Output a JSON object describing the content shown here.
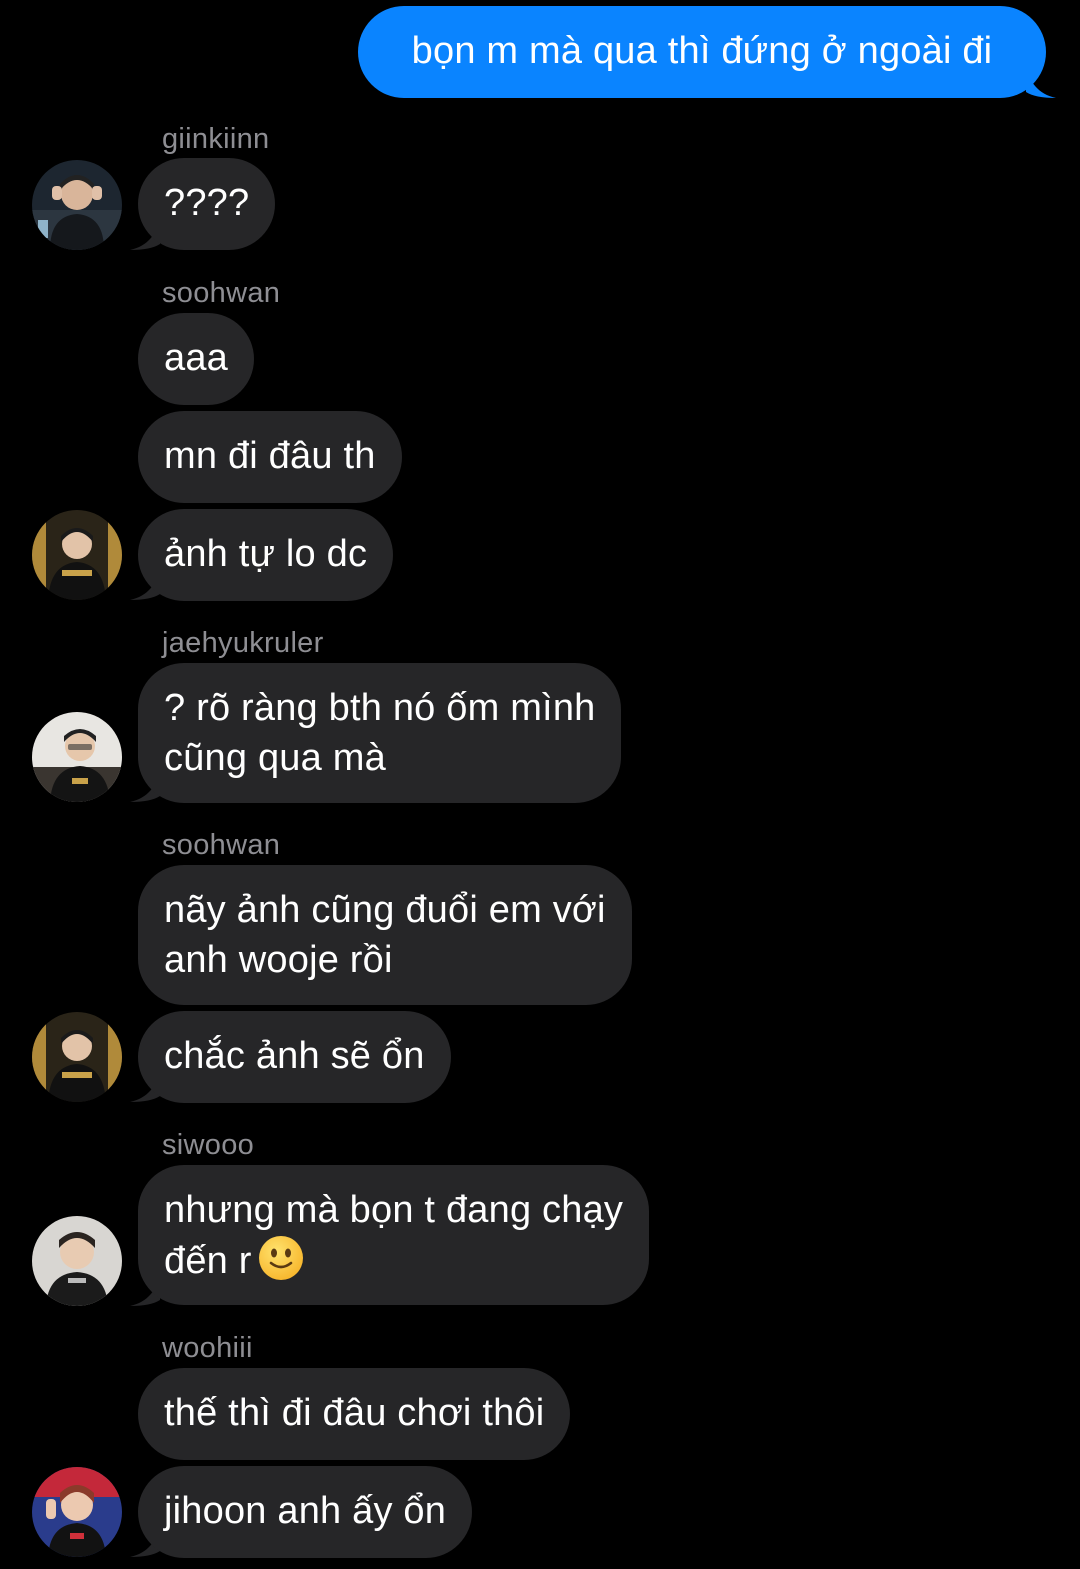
{
  "outgoing": {
    "text": "bọn m mà qua thì đứng ở ngoài đi"
  },
  "messages": {
    "m1": {
      "sender": "giinkiinn",
      "text": "????"
    },
    "m2": {
      "sender": "soohwan",
      "text": "aaa"
    },
    "m3": {
      "text": "mn đi đâu th"
    },
    "m4": {
      "text": "ảnh tự lo dc"
    },
    "m5": {
      "sender": "jaehyukruler",
      "line1": "? rõ ràng bth nó ốm mình",
      "line2": "cũng qua mà"
    },
    "m6": {
      "sender": "soohwan",
      "line1": "nãy ảnh cũng đuổi em với",
      "line2": "anh wooje rồi"
    },
    "m7": {
      "text": "chắc ảnh sẽ ổn"
    },
    "m8": {
      "sender": "siwooo",
      "line1": "nhưng mà bọn t đang chạy",
      "line2": "đến r"
    },
    "m9": {
      "sender": "woohiii",
      "text": "thế thì đi đâu chơi thôi"
    },
    "m10": {
      "text": "jihoon anh ấy ổn"
    }
  },
  "icons": {
    "emoji": "slightly-smiling-face-icon"
  },
  "colors": {
    "background": "#000000",
    "incoming_bubble": "#262628",
    "outgoing_bubble": "#0a84ff",
    "sender_name": "#8e8e93"
  }
}
